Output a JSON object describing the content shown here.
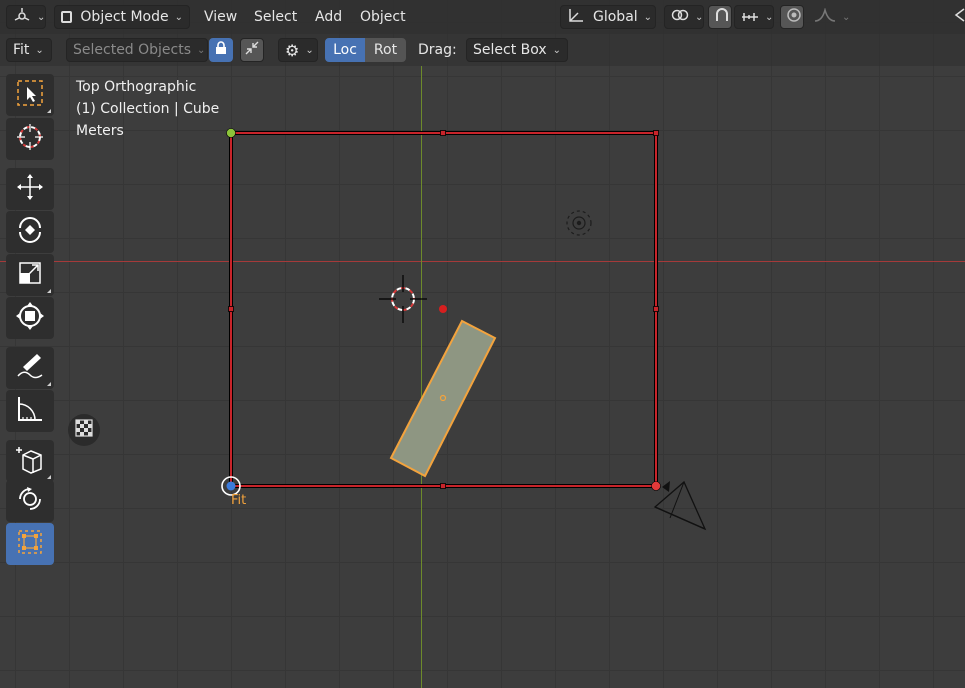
{
  "header": {
    "mode_label": "Object Mode",
    "menus": [
      "View",
      "Select",
      "Add",
      "Object"
    ],
    "orientation_label": "Global"
  },
  "tool_header": {
    "fit_label": "Fit",
    "selected_objects_label": "Selected Objects",
    "loc_label": "Loc",
    "rot_label": "Rot",
    "drag_label": "Drag:",
    "drag_value": "Select Box"
  },
  "overlay": {
    "view_name": "Top Orthographic",
    "collection": "(1) Collection | Cube",
    "units": "Meters"
  },
  "gizmo": {
    "fit_text": "Fit"
  },
  "toolbar": {
    "tools": [
      "select-box-icon",
      "cursor-icon",
      "move-icon",
      "rotate-icon",
      "scale-icon",
      "transform-icon",
      "annotate-icon",
      "measure-icon",
      "add-cube-icon",
      "camera-rotate-icon",
      "uv-select-icon"
    ],
    "active_tool": "uv-select-icon"
  },
  "colors": {
    "accent": "#4772b3",
    "bounds": "#c8242a",
    "selection": "#f3a33d",
    "x_axis": "#a53a3a",
    "y_axis": "#6d8a2b"
  }
}
